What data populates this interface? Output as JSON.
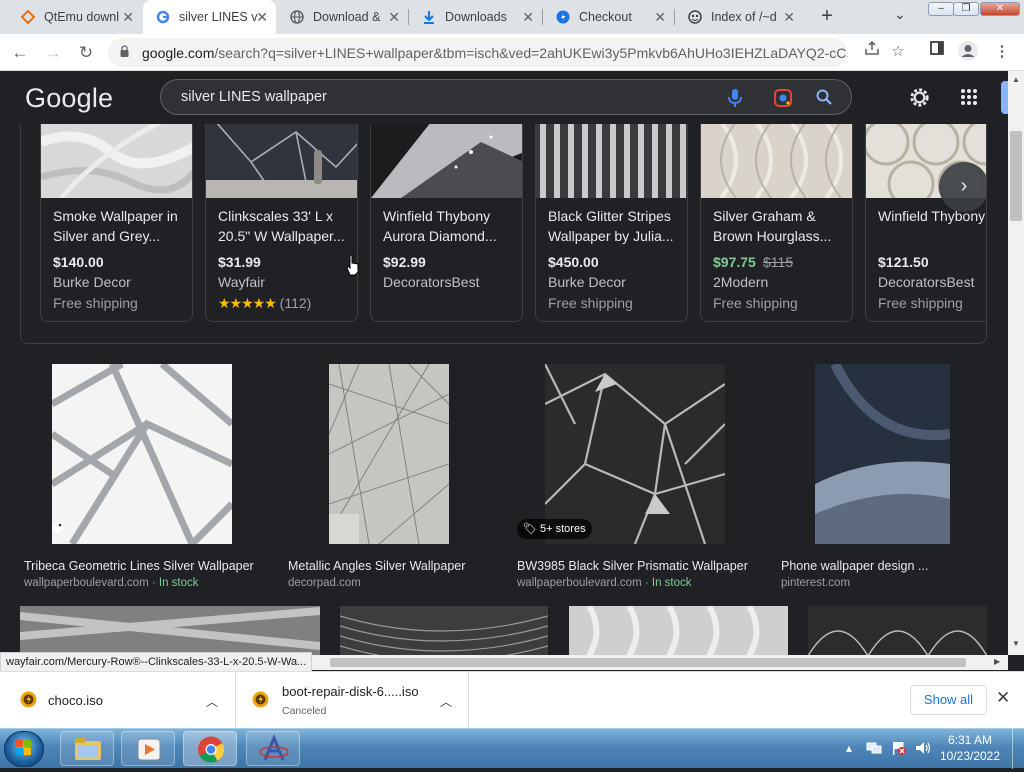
{
  "window": {
    "min_label": "–",
    "max_label": "❐",
    "close_label": "✕"
  },
  "tabs": [
    {
      "title": "QtEmu downl",
      "icon": "qtemu-icon",
      "active": false
    },
    {
      "title": "silver LINES v",
      "icon": "google-icon",
      "active": true
    },
    {
      "title": "Download &",
      "icon": "globe-icon",
      "active": false
    },
    {
      "title": "Downloads",
      "icon": "download-icon",
      "active": false
    },
    {
      "title": "Checkout",
      "icon": "checkout-icon",
      "active": false
    },
    {
      "title": "Index of /~d",
      "icon": "index-icon",
      "active": false
    }
  ],
  "tab_close": "✕",
  "new_tab": "+",
  "address": {
    "host": "google.com",
    "rest": "/search?q=silver+LINES+wallpaper&tbm=isch&ved=2ahUKEwi3y5Pmkvb6AhUHo3IEHZLaDAYQ2-cC..."
  },
  "google": {
    "logo": "Google",
    "query": "silver LINES wallpaper"
  },
  "carousel": [
    {
      "title": "Smoke Wallpaper in Silver and Grey...",
      "price": "$140.00",
      "old_price": "",
      "store": "Burke Decor",
      "extra": "Free shipping",
      "rating_stars": "",
      "rating_count": ""
    },
    {
      "title": "Clinkscales 33' L x 20.5\" W Wallpaper...",
      "price": "$31.99",
      "old_price": "",
      "store": "Wayfair",
      "extra": "",
      "rating_stars": "★★★★★",
      "rating_count": "(112)"
    },
    {
      "title": "Winfield Thybony Aurora Diamond...",
      "price": "$92.99",
      "old_price": "",
      "store": "DecoratorsBest",
      "extra": "",
      "rating_stars": "",
      "rating_count": ""
    },
    {
      "title": "Black Glitter Stripes Wallpaper by Julia...",
      "price": "$450.00",
      "old_price": "",
      "store": "Burke Decor",
      "extra": "Free shipping",
      "rating_stars": "",
      "rating_count": ""
    },
    {
      "title": "Silver Graham & Brown Hourglass...",
      "price": "$97.75",
      "old_price": "$115",
      "store": "2Modern",
      "extra": "Free shipping",
      "rating_stars": "",
      "rating_count": ""
    },
    {
      "title": "Winfield Thybony Perlow Silver Lini",
      "price": "$121.50",
      "old_price": "",
      "store": "DecoratorsBest",
      "extra": "Free shipping",
      "rating_stars": "",
      "rating_count": ""
    }
  ],
  "carousel_next": "›",
  "results": [
    {
      "title": "Tribeca Geometric Lines Silver Wallpaper",
      "source": "wallpaperboulevard.com",
      "stock": " · In stock",
      "tag": ""
    },
    {
      "title": "Metallic Angles Silver Wallpaper",
      "source": "decorpad.com",
      "stock": "",
      "tag": ""
    },
    {
      "title": "BW3985 Black Silver Prismatic Wallpaper",
      "source": "wallpaperboulevard.com",
      "stock": " · In stock",
      "tag": "5+ stores"
    },
    {
      "title": "Phone wallpaper design ...",
      "source": "pinterest.com",
      "stock": "",
      "tag": ""
    }
  ],
  "status_url": "wayfair.com/Mercury-Row®--Clinkscales-33-L-x-20.5-W-Wa...",
  "downloads": [
    {
      "name": "choco.iso",
      "status": ""
    },
    {
      "name": "boot-repair-disk-6.....iso",
      "status": "Canceled"
    }
  ],
  "show_all": "Show all",
  "clock": {
    "time": "6:31 AM",
    "date": "10/23/2022"
  },
  "colors": {
    "accent": "#1a73e8",
    "price_sale": "#81c995",
    "star": "#fbbc04",
    "bg": "#202124"
  }
}
